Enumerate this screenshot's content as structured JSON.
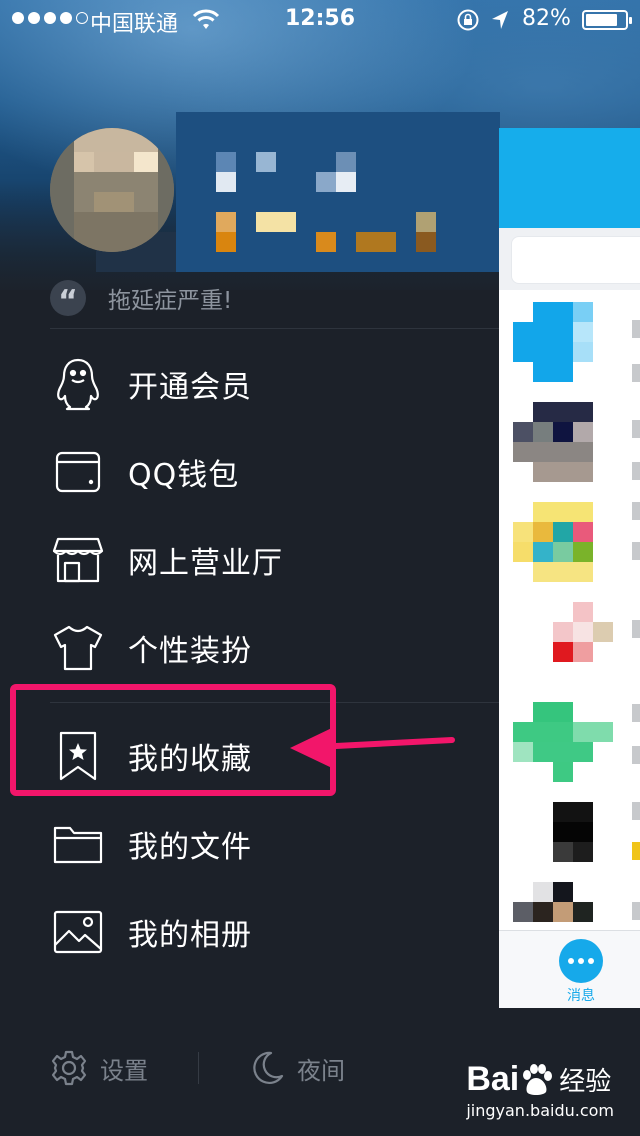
{
  "status_bar": {
    "carrier": "中国联通",
    "time": "12:56",
    "battery_text": "82%",
    "battery_level": 0.82,
    "signal_bars": 4,
    "icons": [
      "signal-dots-icon",
      "wifi-icon",
      "orientation-lock-icon",
      "location-arrow-icon",
      "battery-icon"
    ]
  },
  "profile": {
    "signature": "拖延症严重!",
    "quote_icon": "“"
  },
  "menu": {
    "items": [
      {
        "label": "开通会员",
        "icon": "penguin-icon"
      },
      {
        "label": "QQ钱包",
        "icon": "wallet-icon"
      },
      {
        "label": "网上营业厅",
        "icon": "storefront-icon"
      },
      {
        "label": "个性装扮",
        "icon": "tshirt-icon"
      },
      {
        "label": "我的收藏",
        "icon": "bookmark-star-icon"
      },
      {
        "label": "我的文件",
        "icon": "folder-icon"
      },
      {
        "label": "我的相册",
        "icon": "photo-album-icon"
      }
    ]
  },
  "bottom_bar": {
    "settings_label": "设置",
    "night_label": "夜间"
  },
  "peek_panel": {
    "tab_label": "消息",
    "accent": "#16a9ea"
  },
  "annotation": {
    "highlight_color": "#f2166a"
  },
  "watermark": {
    "brand": "Bai",
    "brand_suffix": "经验",
    "url": "jingyan.baidu.com"
  }
}
